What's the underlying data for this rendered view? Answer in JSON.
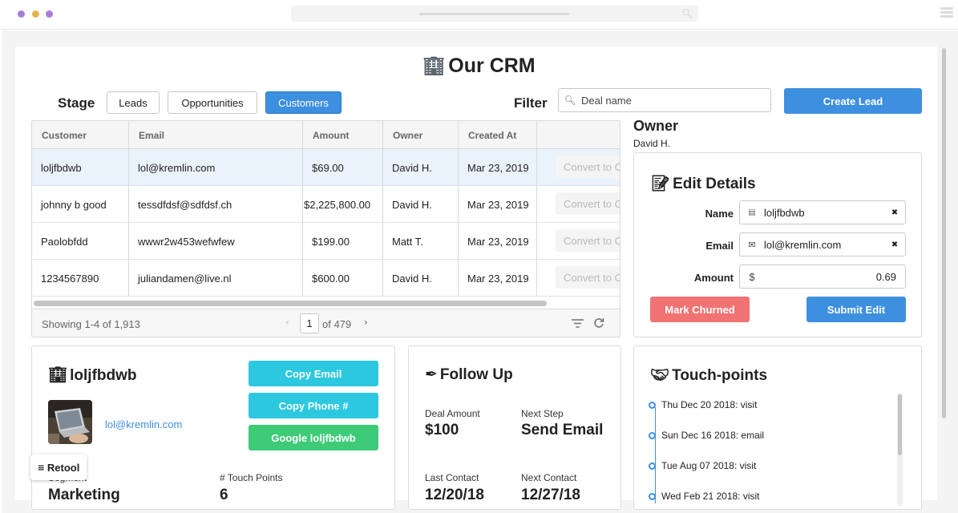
{
  "colors": {
    "accent": "#3d8fdf",
    "cyan": "#2bc8e0",
    "green": "#3ecb78",
    "danger": "#f17373"
  },
  "app": {
    "title": "Our CRM",
    "title_icon": "office-building-icon"
  },
  "stage": {
    "label": "Stage",
    "options": [
      "Leads",
      "Opportunities",
      "Customers"
    ],
    "selected": "Customers"
  },
  "filter": {
    "label": "Filter",
    "placeholder": "Deal name"
  },
  "create_lead_label": "Create Lead",
  "table": {
    "columns": [
      "Customer",
      "Email",
      "Amount",
      "Owner",
      "Created At"
    ],
    "rows": [
      {
        "customer": "loljfbdwb",
        "email": "lol@kremlin.com",
        "amount": "$69.00",
        "owner": "David H.",
        "created": "Mar 23, 2019",
        "action": "Convert to Opportunity"
      },
      {
        "customer": "johnny b good",
        "email": "tessdfdsf@sdfdsf.ch",
        "amount": "$2,225,800.00",
        "owner": "David H.",
        "created": "Mar 23, 2019",
        "action": "Convert to Opportunity"
      },
      {
        "customer": "Paolobfdd",
        "email": "wwwr2w453wefwfew",
        "amount": "$199.00",
        "owner": "Matt T.",
        "created": "Mar 23, 2019",
        "action": "Convert to Opportunity"
      },
      {
        "customer": "1234567890",
        "email": "juliandamen@live.nl",
        "amount": "$600.00",
        "owner": "David H.",
        "created": "Mar 23, 2019",
        "action": "Convert to Opportunity"
      }
    ],
    "footer": {
      "showing": "Showing 1-4 of 1,913",
      "page": "1",
      "of_pages": "of 479"
    }
  },
  "owner": {
    "label": "Owner",
    "value": "David H."
  },
  "edit_details": {
    "title": "Edit Details",
    "icon": "memo-icon",
    "name_label": "Name",
    "name_value": "loljfbdwb",
    "email_label": "Email",
    "email_value": "lol@kremlin.com",
    "amount_label": "Amount",
    "amount_prefix": "$",
    "amount_value": "0.69",
    "mark_churned": "Mark Churned",
    "submit_edit": "Submit Edit"
  },
  "customer_card": {
    "name": "loljfbdwb",
    "email_link": "lol@kremlin.com",
    "copy_email": "Copy Email",
    "copy_phone": "Copy Phone #",
    "google": "Google loljfbdwb",
    "segment_label": "Segment",
    "segment_value": "Marketing",
    "touch_label": "# Touch Points",
    "touch_value": "6"
  },
  "follow_up": {
    "title": "Follow Up",
    "icon": "pen-icon",
    "deal_amount_label": "Deal Amount",
    "deal_amount_value": "$100",
    "next_step_label": "Next Step",
    "next_step_value": "Send Email",
    "last_contact_label": "Last Contact",
    "last_contact_value": "12/20/18",
    "next_contact_label": "Next Contact",
    "next_contact_value": "12/27/18"
  },
  "touch_points": {
    "title": "Touch-points",
    "icon": "handshake-icon",
    "items": [
      "Thu Dec 20 2018: visit",
      "Sun Dec 16 2018: email",
      "Tue Aug 07 2018: visit",
      "Wed Feb 21 2018: visit"
    ]
  },
  "retool_badge": "Retool"
}
